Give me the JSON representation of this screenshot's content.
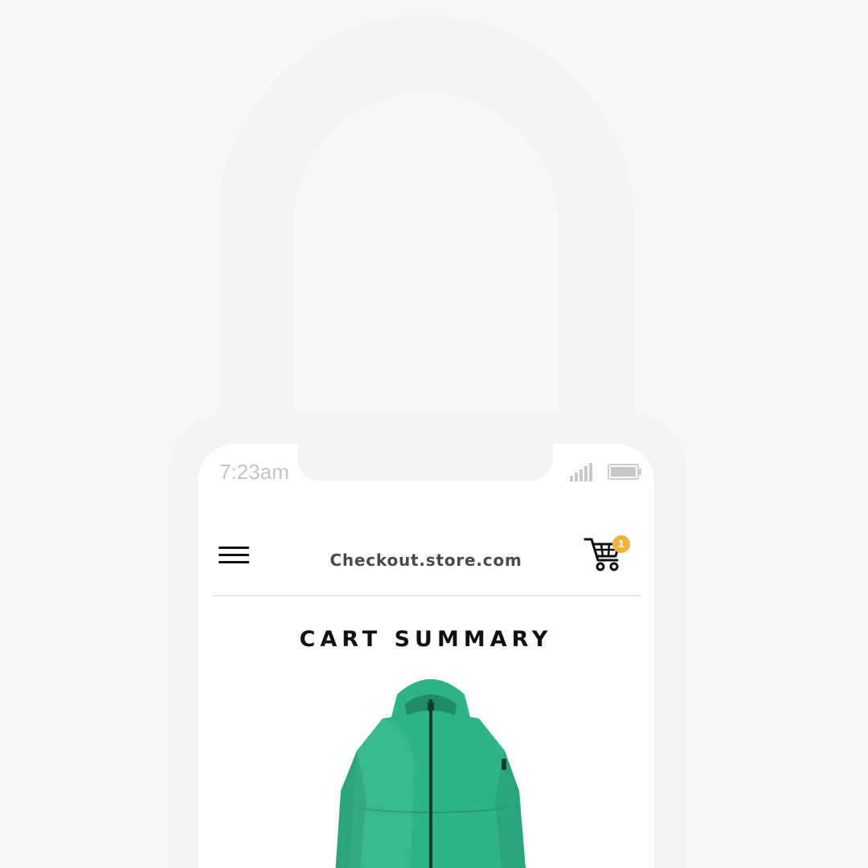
{
  "status_bar": {
    "time": "7:23am",
    "signal_icon": "signal-bars-icon",
    "battery_icon": "battery-icon"
  },
  "header": {
    "menu_icon": "hamburger-menu-icon",
    "site_title": "Checkout.store.com",
    "cart_icon": "shopping-cart-icon",
    "cart_count": "1"
  },
  "main": {
    "heading": "CART SUMMARY",
    "product_image": "green-hooded-jacket"
  },
  "colors": {
    "background": "#f7f7f7",
    "frame": "#f2f4f4",
    "screen": "#ffffff",
    "badge": "#f0b43c",
    "jacket": "#2eb487"
  }
}
